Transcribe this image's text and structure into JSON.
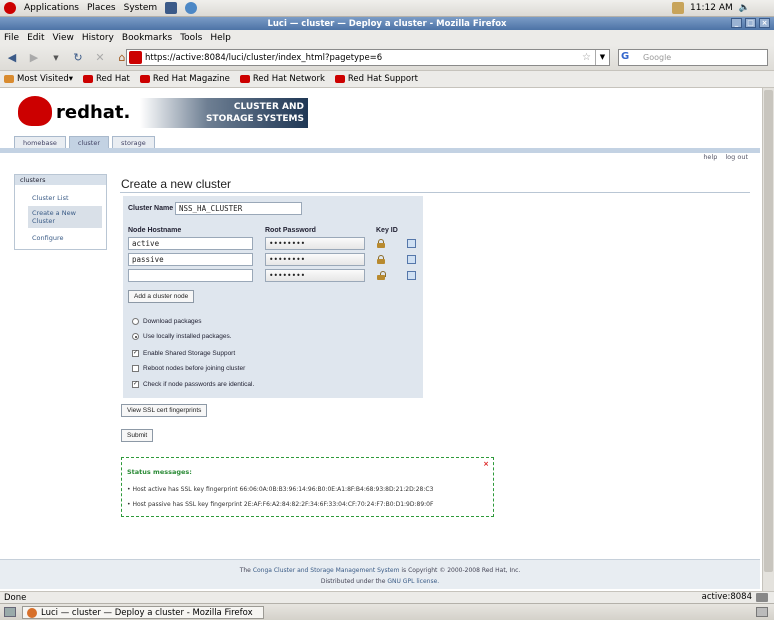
{
  "gnome_panel": {
    "menus": [
      "Applications",
      "Places",
      "System"
    ],
    "clock": "11:12 AM"
  },
  "window": {
    "title": "Luci — cluster — Deploy a cluster - Mozilla Firefox"
  },
  "menubar": [
    "File",
    "Edit",
    "View",
    "History",
    "Bookmarks",
    "Tools",
    "Help"
  ],
  "nav": {
    "url": "https://active:8084/luci/cluster/index_html?pagetype=6",
    "search_placeholder": "Google"
  },
  "bookmarks": [
    "Most Visited▾",
    "Red Hat",
    "Red Hat Magazine",
    "Red Hat Network",
    "Red Hat Support"
  ],
  "page": {
    "logo_text": "redhat.",
    "banner_line1": "CLUSTER AND",
    "banner_line2": "STORAGE SYSTEMS",
    "tabs": [
      "homebase",
      "cluster",
      "storage"
    ],
    "help_links": [
      "help",
      "log out"
    ],
    "sidebar": {
      "heading": "clusters",
      "items": [
        "Cluster List",
        "Create a New Cluster",
        "Configure"
      ]
    },
    "title": "Create a new cluster",
    "form": {
      "cluster_name_label": "Cluster Name",
      "cluster_name_value": "NSS_HA_CLUSTER",
      "col_hostname": "Node Hostname",
      "col_password": "Root Password",
      "col_keyid": "Key ID",
      "nodes": [
        {
          "hostname": "active",
          "password": "••••••••"
        },
        {
          "hostname": "passive",
          "password": "••••••••"
        },
        {
          "hostname": "",
          "password": "••••••••"
        }
      ],
      "add_node_button": "Add a cluster node",
      "opt_download": "Download packages",
      "opt_local": "Use locally installed packages.",
      "opt_shared_storage": "Enable Shared Storage Support",
      "opt_reboot": "Reboot nodes before joining cluster",
      "opt_identical_pw": "Check if node passwords are identical."
    },
    "view_ssl_button": "View SSL cert fingerprints",
    "submit_button": "Submit",
    "status": {
      "title": "Status messages:",
      "messages": [
        "Host active has SSL key fingerprint 66:06:0A:0B:B3:96:14:96:B0:0E:A1:8F:B4:68:93:8D:21:2D:28:C3",
        "Host passive has SSL key fingerprint 2E:AF:F6:A2:84:82:2F:34:6F:33:04:CF:70:24:F7:B0:D1:9D:89:0F"
      ]
    },
    "footer": {
      "line1_prefix": "The",
      "line1_link": "Conga Cluster and Storage Management System",
      "line1_suffix": "is Copyright © 2000-2008 Red Hat, Inc.",
      "line2_prefix": "Distributed under the",
      "line2_link": "GNU GPL license."
    }
  },
  "statusbar": {
    "text": "Done",
    "right": "active:8084"
  },
  "taskbar": {
    "window_button": "Luci — cluster — Deploy a cluster - Mozilla Firefox"
  }
}
